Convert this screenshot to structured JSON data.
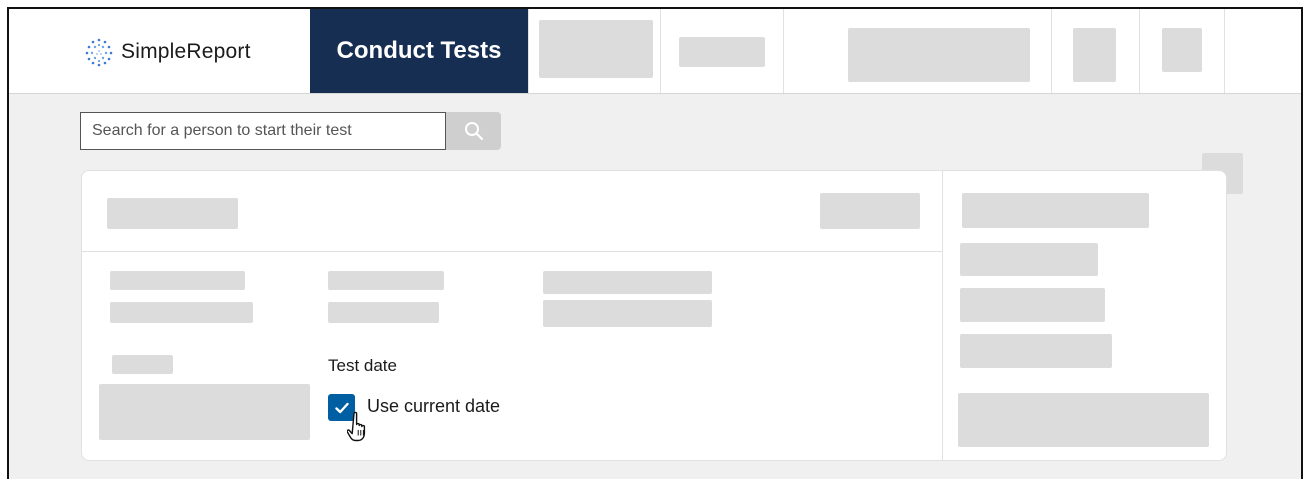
{
  "brand": {
    "name": "SimpleReport",
    "logo_icon": "dotted-circle-logo-icon"
  },
  "nav": {
    "active_tab": "Conduct Tests"
  },
  "search": {
    "placeholder": "Search for a person to start their test",
    "button_icon": "search-icon"
  },
  "test_form": {
    "test_date_label": "Test date",
    "use_current_date_label": "Use current date",
    "use_current_date_checked": true
  },
  "colors": {
    "nav_active_bg": "#162e51",
    "checkbox_bg": "#005ea2",
    "placeholder_gray": "#dcdcdc",
    "page_bg": "#f0f0f0"
  }
}
